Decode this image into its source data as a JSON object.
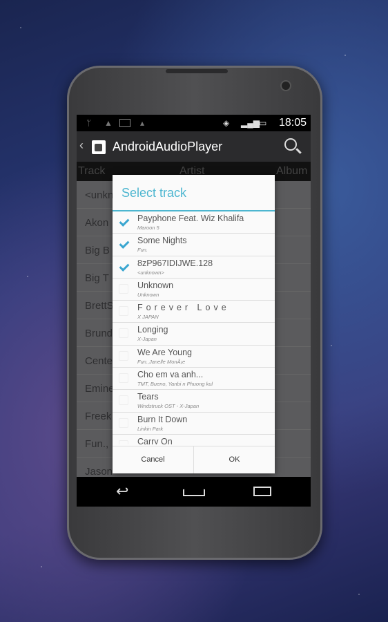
{
  "status": {
    "time": "18:05"
  },
  "app": {
    "title": "AndroidAudioPlayer"
  },
  "columns": [
    "Track",
    "Artist",
    "Album"
  ],
  "background_list": [
    "<unkn",
    "Akon",
    "Big B",
    "Big T",
    "BrettS",
    "Brund",
    "Cente",
    "Emine",
    "Freek",
    "Fun.,",
    "Jason"
  ],
  "dialog": {
    "title": "Select track",
    "cancel": "Cancel",
    "ok": "OK",
    "items": [
      {
        "name": "Payphone Feat. Wiz Khalifa",
        "artist": "Maroon 5",
        "checked": true
      },
      {
        "name": "Some Nights",
        "artist": "Fun.",
        "checked": true
      },
      {
        "name": "8zP967IDIJWE.128",
        "artist": "<unknown>",
        "checked": true
      },
      {
        "name": "Unknown",
        "artist": "Unknown",
        "checked": false
      },
      {
        "name": "Forever Love",
        "artist": "X JAPAN",
        "checked": false
      },
      {
        "name": "Longing",
        "artist": "X-Japan",
        "checked": false
      },
      {
        "name": "We Are Young",
        "artist": "Fun.,Janelle MonÃ¡e",
        "checked": false
      },
      {
        "name": "Cho em va anh...",
        "artist": "TMT, Bueno, Yanbi n Phuong kul",
        "checked": false
      },
      {
        "name": "Tears",
        "artist": "Windstruck OST - X-Japan",
        "checked": false
      },
      {
        "name": "Burn It Down",
        "artist": "Linkin Park",
        "checked": false
      },
      {
        "name": "Carry On",
        "artist": "",
        "checked": false
      }
    ]
  },
  "colors": {
    "accent": "#4db6d0",
    "check": "#3aa6d0"
  }
}
